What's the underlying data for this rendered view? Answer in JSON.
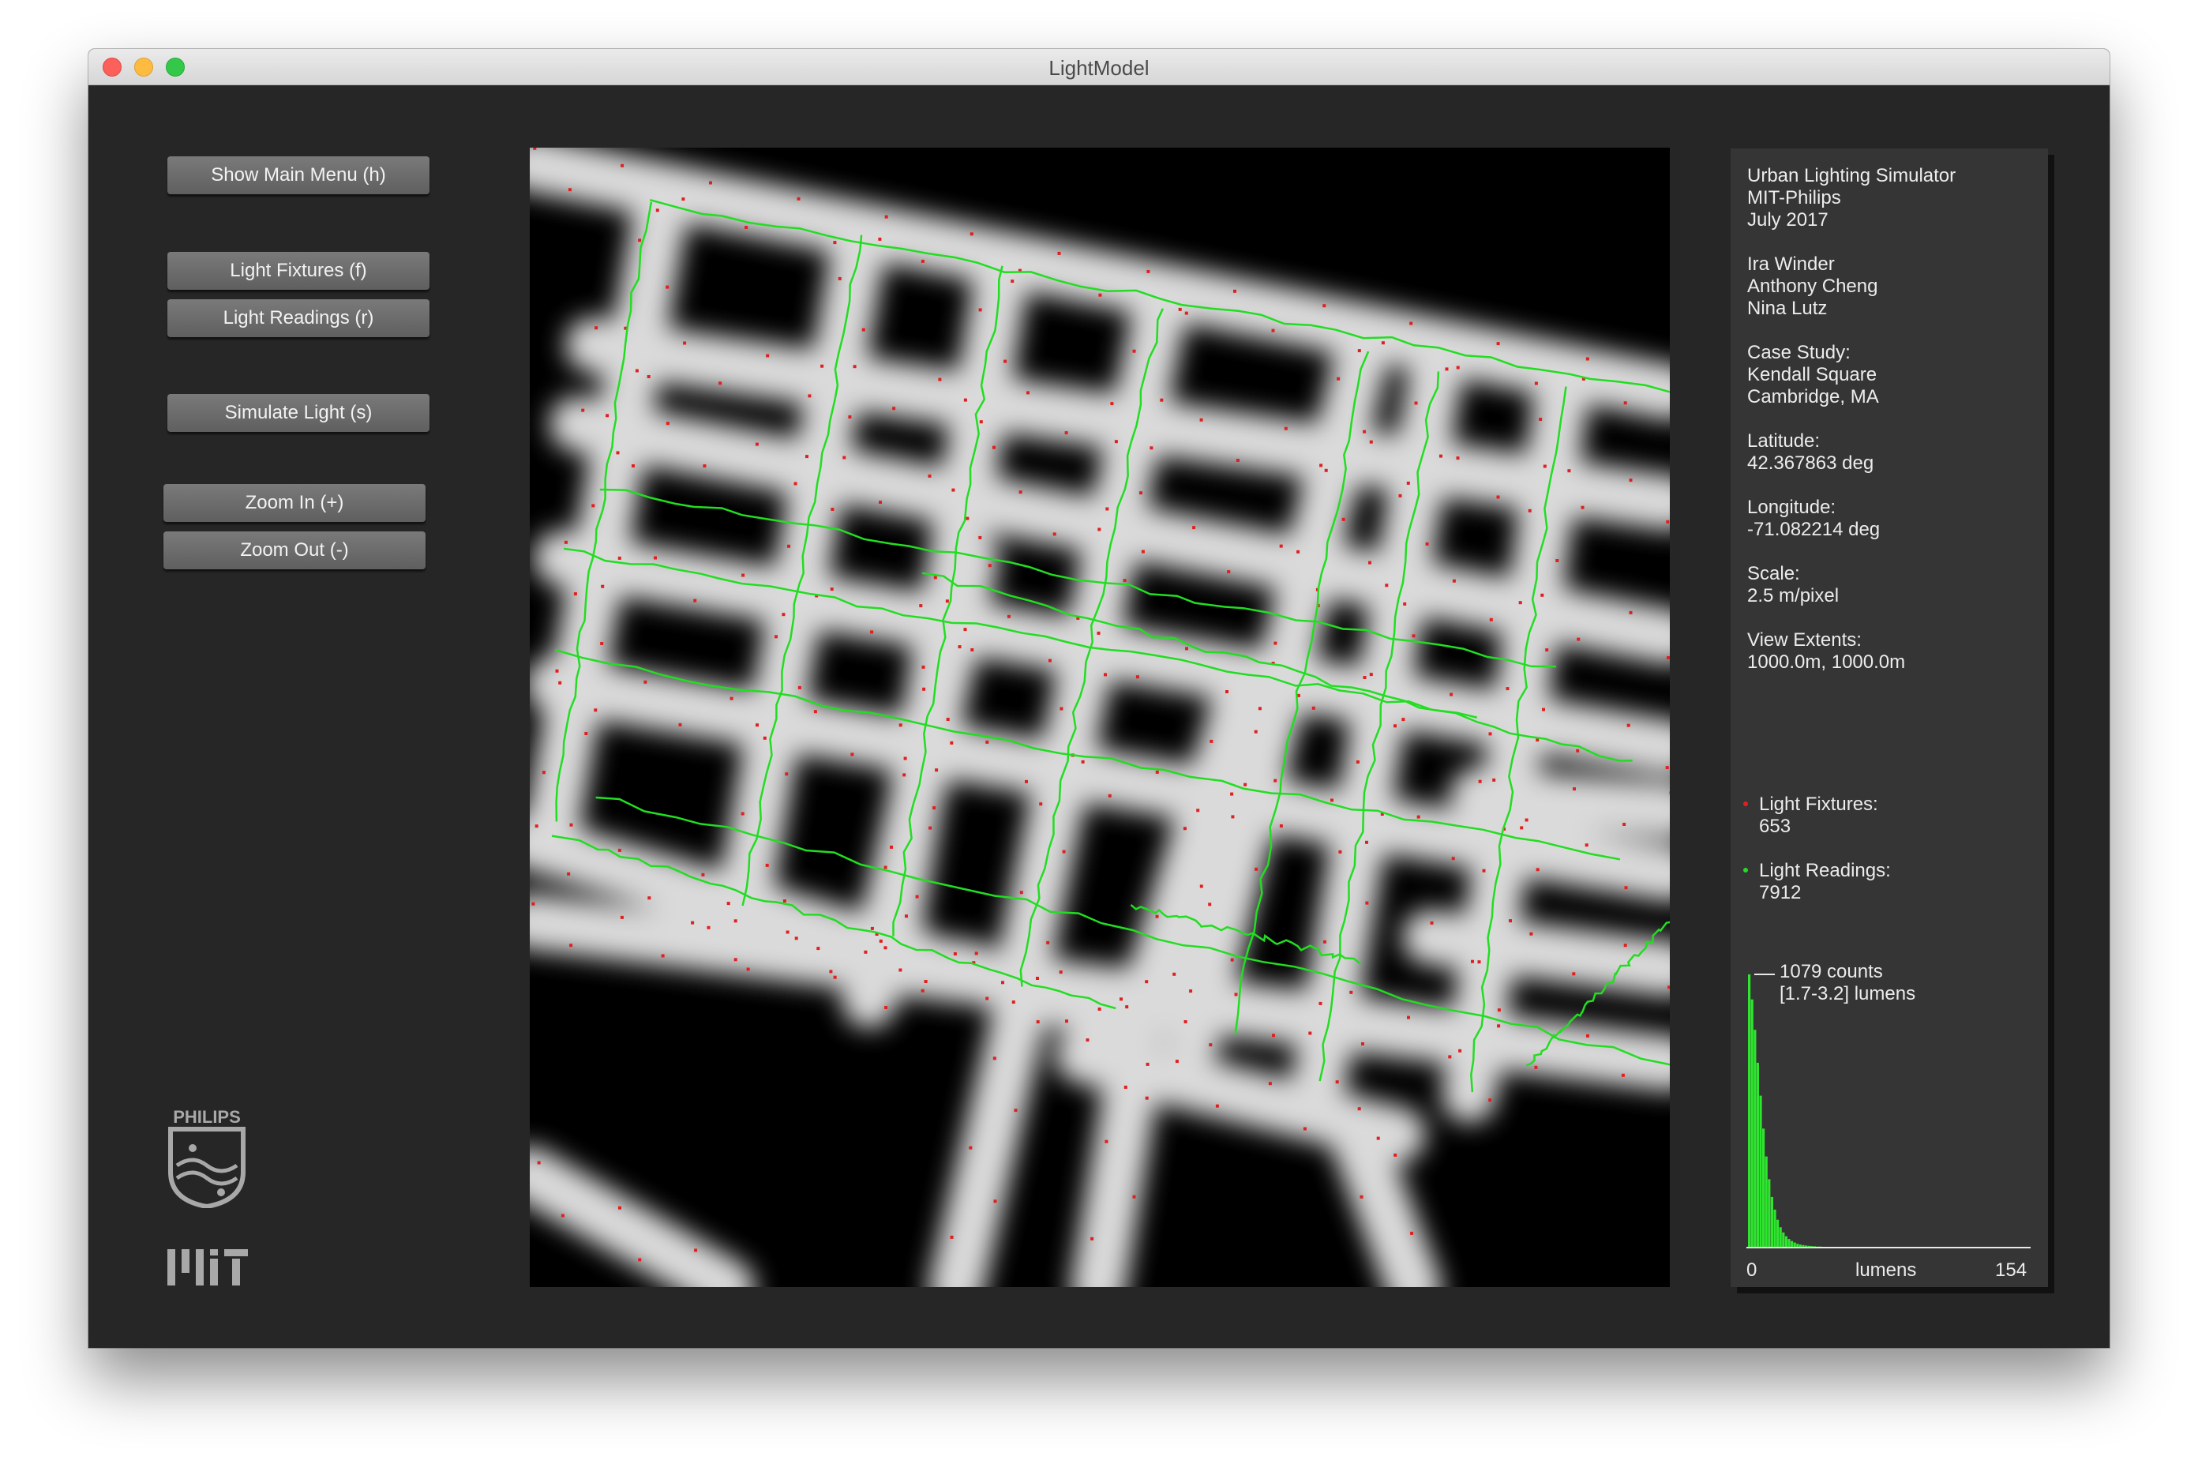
{
  "window": {
    "title": "LightModel"
  },
  "menu": {
    "show_main_menu": "Show Main Menu (h)",
    "light_fixtures": "Light Fixtures (f)",
    "light_readings": "Light Readings (r)",
    "simulate_light": "Simulate Light (s)",
    "zoom_in": "Zoom In (+)",
    "zoom_out": "Zoom Out (-)"
  },
  "info": {
    "app_title": "Urban Lighting Simulator",
    "org": "MIT-Philips",
    "date": "July 2017",
    "authors": [
      "Ira Winder",
      "Anthony Cheng",
      "Nina Lutz"
    ],
    "case_study_label": "Case Study:",
    "case_study_name": "Kendall Square",
    "case_study_place": "Cambridge, MA",
    "latitude_label": "Latitude:",
    "latitude_value": "42.367863 deg",
    "longitude_label": "Longitude:",
    "longitude_value": "-71.082214 deg",
    "scale_label": "Scale:",
    "scale_value": "2.5 m/pixel",
    "extents_label": "View Extents:",
    "extents_value": "1000.0m, 1000.0m"
  },
  "legend": {
    "fixtures_label": "Light Fixtures:",
    "fixtures_count": "653",
    "fixtures_color": "#e02020",
    "readings_label": "Light Readings:",
    "readings_count": "7912",
    "readings_color": "#22dd22"
  },
  "histogram": {
    "peak_label": "1079 counts",
    "range_label": "[1.7-3.2] lumens",
    "x_min": "0",
    "x_label": "lumens",
    "x_max": "154",
    "bar_color": "#2ee62e",
    "peak_count": 1079,
    "bins": [
      1079,
      980,
      860,
      730,
      600,
      470,
      360,
      270,
      200,
      150,
      110,
      80,
      60,
      45,
      34,
      26,
      20,
      15,
      12,
      10,
      8,
      7,
      6,
      5,
      4,
      4,
      3,
      3,
      2,
      2,
      2,
      2,
      1,
      1,
      1,
      1,
      1,
      1,
      1,
      1
    ]
  },
  "logos": {
    "philips_text": "PHILIPS",
    "mit_text": "MIT"
  }
}
